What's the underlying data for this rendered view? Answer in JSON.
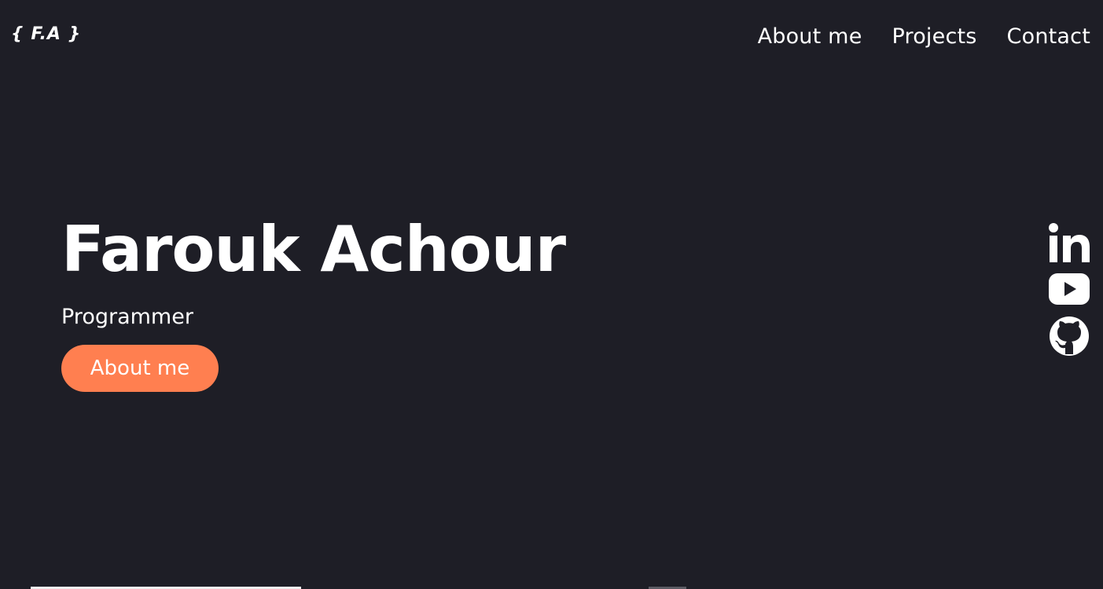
{
  "header": {
    "logo_text": "{ F.A }",
    "nav": [
      {
        "label": "About me"
      },
      {
        "label": "Projects"
      },
      {
        "label": "Contact"
      }
    ]
  },
  "hero": {
    "name": "Farouk Achour",
    "role": "Programmer",
    "cta_label": "About me"
  },
  "social": [
    {
      "icon": "linkedin-icon"
    },
    {
      "icon": "youtube-icon"
    },
    {
      "icon": "github-icon"
    }
  ],
  "colors": {
    "background": "#1e1e26",
    "text": "#ffffff",
    "accent": "#ff7f50"
  }
}
